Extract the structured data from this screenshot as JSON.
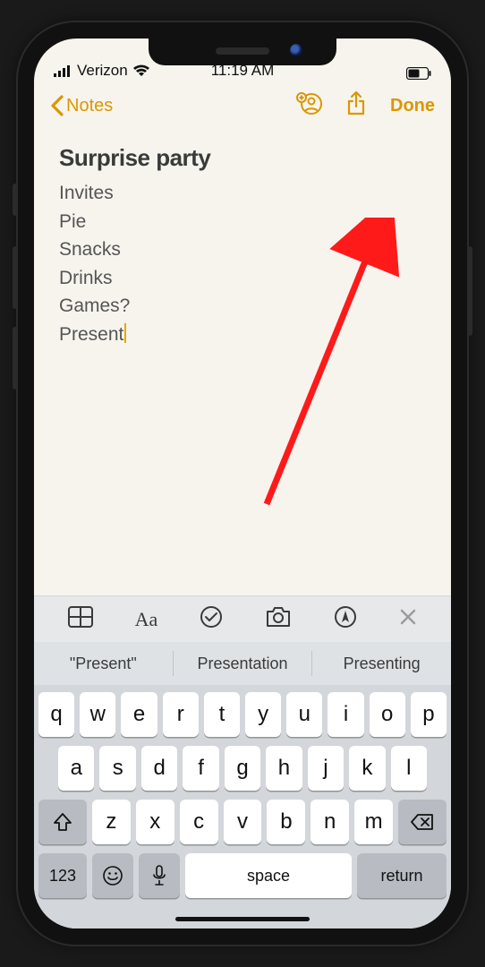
{
  "statusbar": {
    "carrier": "Verizon",
    "time": "11:19 AM"
  },
  "nav": {
    "back_label": "Notes",
    "done_label": "Done"
  },
  "note": {
    "title": "Surprise party",
    "lines": [
      "Invites",
      "Pie",
      "Snacks",
      "Drinks",
      "Games?",
      "Present"
    ]
  },
  "suggestions": [
    "\"Present\"",
    "Presentation",
    "Presenting"
  ],
  "keyboard": {
    "row1": [
      "q",
      "w",
      "e",
      "r",
      "t",
      "y",
      "u",
      "i",
      "o",
      "p"
    ],
    "row2": [
      "a",
      "s",
      "d",
      "f",
      "g",
      "h",
      "j",
      "k",
      "l"
    ],
    "row3": [
      "z",
      "x",
      "c",
      "v",
      "b",
      "n",
      "m"
    ],
    "num_label": "123",
    "space_label": "space",
    "return_label": "return"
  },
  "colors": {
    "accent": "#db9700"
  }
}
